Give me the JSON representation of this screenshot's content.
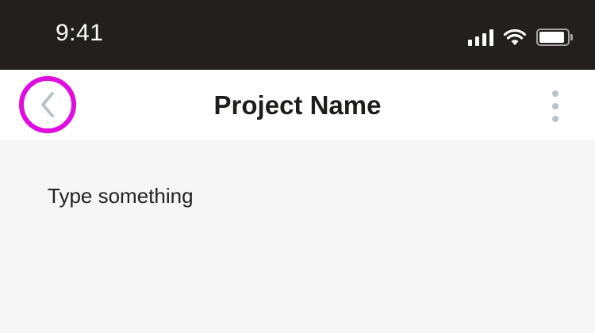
{
  "status_bar": {
    "time": "9:41",
    "signal_icon": "cellular-signal-icon",
    "wifi_icon": "wifi-icon",
    "battery_icon": "battery-icon",
    "battery_level": 0.9
  },
  "nav_bar": {
    "back_icon": "chevron-left-icon",
    "title": "Project Name",
    "more_icon": "vertical-ellipsis-icon",
    "highlight_color": "#e00ce0"
  },
  "editor": {
    "placeholder": "Type something"
  },
  "colors": {
    "status_bar_bg": "#221f1e",
    "nav_bg": "#ffffff",
    "content_bg": "#f6f6f6",
    "icon_gray": "#b9c3c9"
  }
}
